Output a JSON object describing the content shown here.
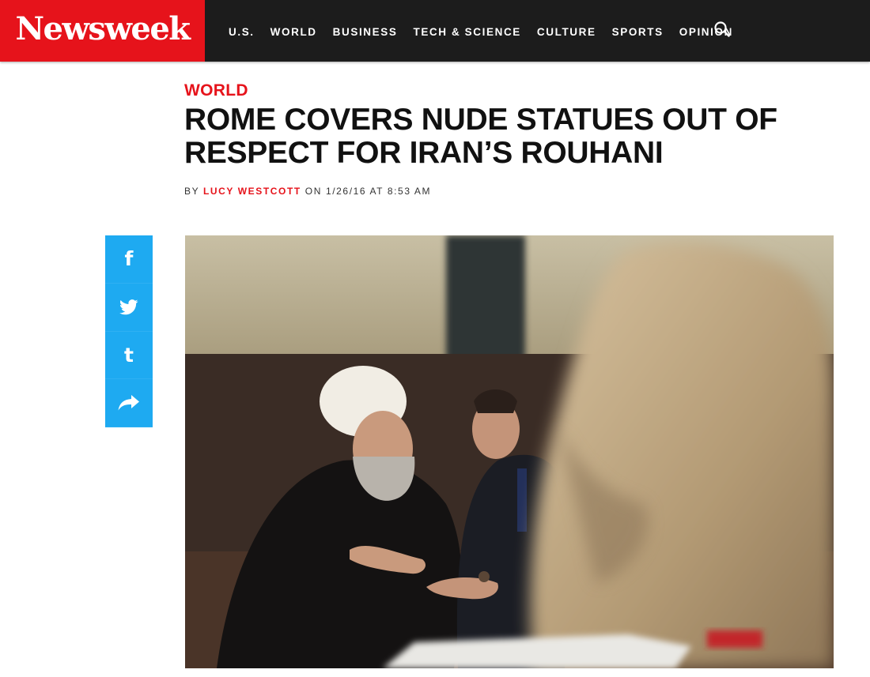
{
  "brand": {
    "logo_text": "Newsweek",
    "accent_color": "#e6131b",
    "header_bg": "#1c1c1c",
    "share_color": "#1eaaf1"
  },
  "nav": {
    "items": [
      "U.S.",
      "WORLD",
      "BUSINESS",
      "TECH & SCIENCE",
      "CULTURE",
      "SPORTS",
      "OPINION"
    ],
    "search_icon": "search-icon"
  },
  "article": {
    "section": "WORLD",
    "headline": "ROME COVERS NUDE STATUES OUT OF RESPECT FOR IRAN’S ROUHANI",
    "byline_prefix": "BY",
    "author": "LUCY WESTCOTT",
    "byline_on": "ON",
    "date": "1/26/16",
    "byline_at": "AT",
    "time": "8:53 AM"
  },
  "share": {
    "facebook_glyph": "f",
    "twitter_icon": "twitter-bird-icon",
    "tumblr_glyph": "t",
    "share_icon": "share-arrow-icon"
  },
  "hero": {
    "icon": "photo-icon"
  }
}
